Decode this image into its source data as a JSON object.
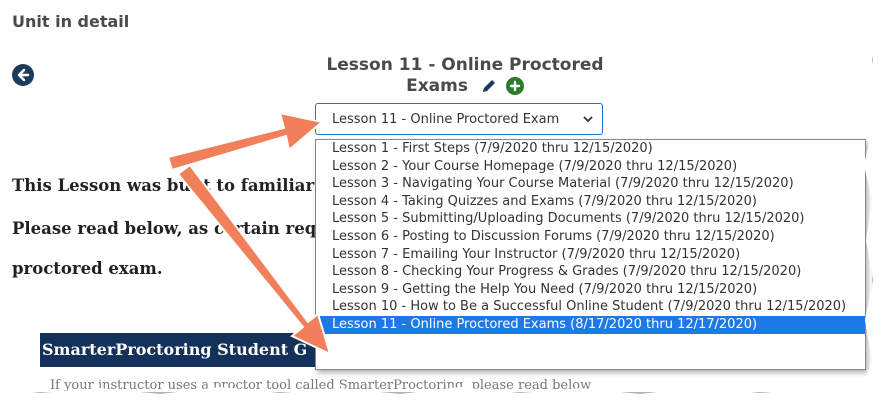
{
  "header": {
    "unit_title": "Unit in detail"
  },
  "lesson": {
    "title_line1": "Lesson 11 - Online Proctored",
    "title_line2": "Exams"
  },
  "selector": {
    "selected_value": "Lesson 11 - Online Proctored Exam",
    "options": [
      "Lesson 1 - First Steps (7/9/2020 thru 12/15/2020)",
      "Lesson 2 - Your Course Homepage (7/9/2020 thru 12/15/2020)",
      "Lesson 3 - Navigating Your Course Material (7/9/2020 thru 12/15/2020)",
      "Lesson 4 - Taking Quizzes and Exams (7/9/2020 thru 12/15/2020)",
      "Lesson 5 - Submitting/Uploading Documents (7/9/2020 thru 12/15/2020)",
      "Lesson 6 - Posting to Discussion Forums (7/9/2020 thru 12/15/2020)",
      "Lesson 7 - Emailing Your Instructor (7/9/2020 thru 12/15/2020)",
      "Lesson 8 - Checking Your Progress & Grades (7/9/2020 thru 12/15/2020)",
      "Lesson 9 - Getting the Help You Need (7/9/2020 thru 12/15/2020)",
      "Lesson 10 - How to Be a Successful Online Student (7/9/2020 thru 12/15/2020)",
      "Lesson 11 - Online Proctored Exams (8/17/2020 thru 12/17/2020)"
    ],
    "selected_index": 10
  },
  "content": {
    "line1": "This Lesson was built to familiar",
    "line2": "Please read below, as certain req",
    "line3": "proctored exam.",
    "banner": "SmarterProctoring Student G",
    "partial": "If your instructor uses a proctor tool called SmarterProctoring, please read below"
  },
  "colors": {
    "arrow": "#f07f5a",
    "banner": "#14315a",
    "selection": "#1e78e6"
  }
}
